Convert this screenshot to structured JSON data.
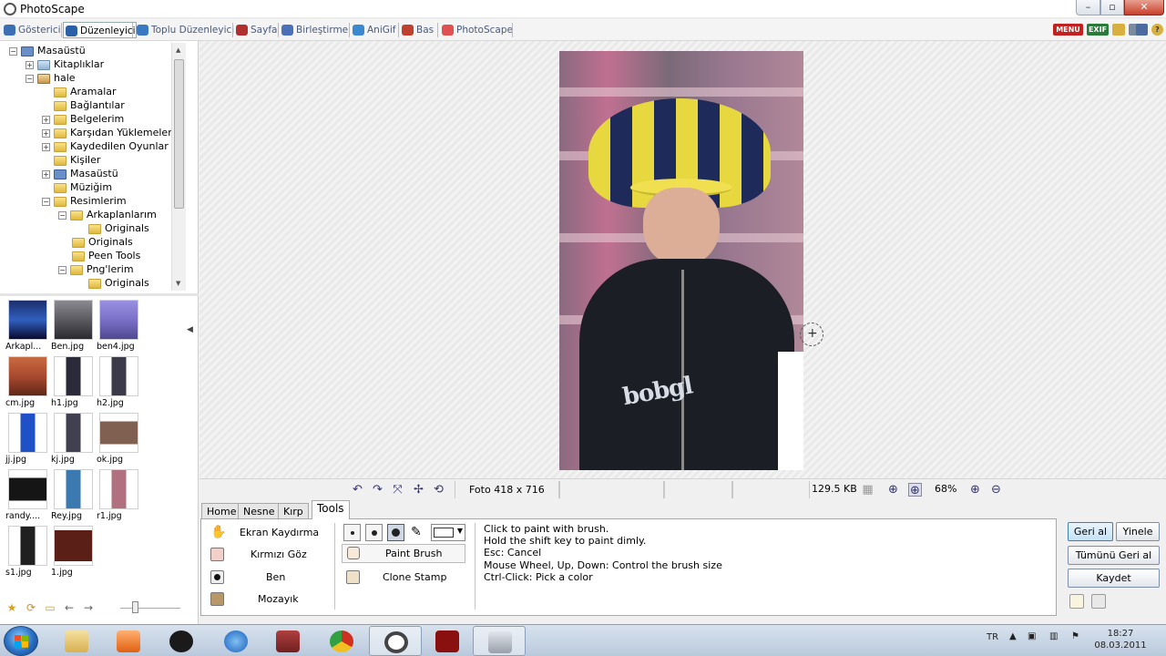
{
  "window": {
    "title": "PhotoScape"
  },
  "tabs": [
    {
      "label": "Gösterici",
      "color": "#3d6fb5"
    },
    {
      "label": "Düzenleyici",
      "color": "#2b5fa8",
      "active": true
    },
    {
      "label": "Toplu Düzenleyici",
      "color": "#3a78c0"
    },
    {
      "label": "Sayfa",
      "color": "#b03030"
    },
    {
      "label": "Birleştirme",
      "color": "#4a70b8"
    },
    {
      "label": "AniGif",
      "color": "#3b8ad0"
    },
    {
      "label": "Bas",
      "color": "#c04030"
    },
    {
      "label": "PhotoScape",
      "color": "#e05050"
    }
  ],
  "top_right": {
    "menu": "MENU",
    "exif": "EXIF"
  },
  "tree": [
    {
      "label": "Masaüstü",
      "icon": "desk",
      "exp": "−"
    },
    {
      "label": "Kitaplıklar",
      "icon": "lib",
      "exp": "+"
    },
    {
      "label": "hale",
      "icon": "user",
      "exp": "−"
    },
    {
      "label": "Aramalar",
      "icon": "folder",
      "exp": ""
    },
    {
      "label": "Bağlantılar",
      "icon": "folder",
      "exp": ""
    },
    {
      "label": "Belgelerim",
      "icon": "folder",
      "exp": "+"
    },
    {
      "label": "Karşıdan Yüklemeler",
      "icon": "folder",
      "exp": "+"
    },
    {
      "label": "Kaydedilen Oyunlar",
      "icon": "folder",
      "exp": "+"
    },
    {
      "label": "Kişiler",
      "icon": "folder",
      "exp": ""
    },
    {
      "label": "Masaüstü",
      "icon": "desk",
      "exp": "+"
    },
    {
      "label": "Müziğim",
      "icon": "folder",
      "exp": ""
    },
    {
      "label": "Resimlerim",
      "icon": "folder",
      "exp": "−"
    },
    {
      "label": "Arkaplanlarım",
      "icon": "folder",
      "exp": "−"
    },
    {
      "label": "Originals",
      "icon": "folder",
      "exp": ""
    },
    {
      "label": "Originals",
      "icon": "folder",
      "exp": ""
    },
    {
      "label": "Peen Tools",
      "icon": "folder",
      "exp": ""
    },
    {
      "label": "Png'lerim",
      "icon": "folder",
      "exp": "−"
    },
    {
      "label": "Originals",
      "icon": "folder",
      "exp": ""
    }
  ],
  "thumbnails": [
    {
      "label": "Arkapl...",
      "color": "#1b2e6a"
    },
    {
      "label": "Ben.jpg",
      "color": "#5a5a60"
    },
    {
      "label": "ben4.jpg",
      "color": "#7a70c8"
    },
    {
      "label": "cm.jpg",
      "color": "#a84a30"
    },
    {
      "label": "h1.jpg",
      "color": "#2a2a3a"
    },
    {
      "label": "h2.jpg",
      "color": "#3a3a48"
    },
    {
      "label": "jj.jpg",
      "color": "#2050c8"
    },
    {
      "label": "kj.jpg",
      "color": "#404050"
    },
    {
      "label": "ok.jpg",
      "color": "#806050"
    },
    {
      "label": "randy....",
      "color": "#151515"
    },
    {
      "label": "Rey.jpg",
      "color": "#3a7ab0"
    },
    {
      "label": "r1.jpg",
      "color": "#b07080"
    },
    {
      "label": "s1.jpg",
      "color": "#202020"
    },
    {
      "label": "1.jpg",
      "color": "#5a2018"
    }
  ],
  "status": {
    "photo_size": "Foto 418 x 716",
    "file_size": "129.5 KB",
    "zoom": "68%"
  },
  "bottom_tabs": [
    {
      "label": "Home"
    },
    {
      "label": "Nesne"
    },
    {
      "label": "Kırp"
    },
    {
      "label": "Tools",
      "active": true
    }
  ],
  "tools": {
    "left": [
      "Ekran Kaydırma",
      "Kırmızı Göz",
      "Ben",
      "Mozayık"
    ],
    "brush": [
      "Paint Brush",
      "Clone Stamp"
    ],
    "help": "Click to paint with brush.\nHold the shift key to paint dimly.\nEsc: Cancel\nMouse Wheel, Up, Down: Control the brush size\nCtrl-Click: Pick a color",
    "brush_color": "#ffffff"
  },
  "actions": {
    "undo": "Geri al",
    "redo": "Yinele",
    "undo_all": "Tümünü Geri al",
    "save": "Kaydet"
  },
  "taskbar": {
    "lang": "TR",
    "time": "18:27",
    "date": "08.03.2011",
    "apps": [
      "explorer",
      "media-player",
      "hp",
      "internet-explorer",
      "winrar",
      "chrome",
      "photoscape",
      "raw",
      "camera"
    ]
  }
}
